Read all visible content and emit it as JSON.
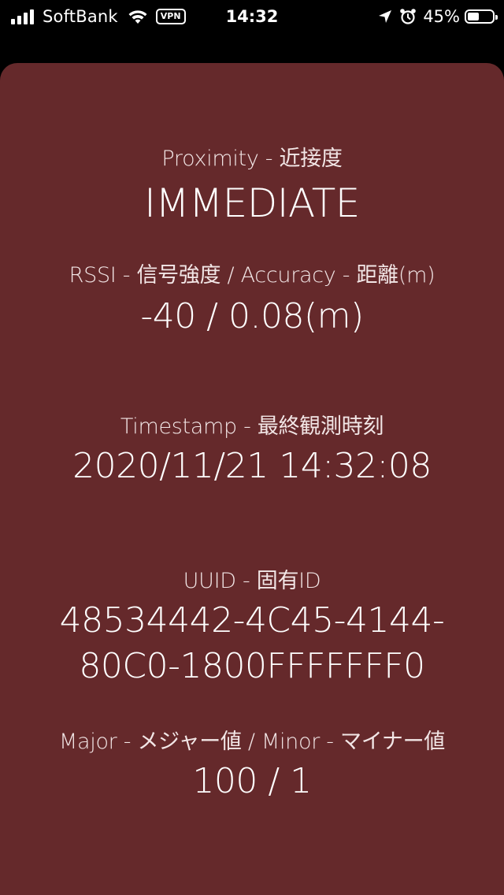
{
  "status_bar": {
    "carrier": "SoftBank",
    "vpn_label": "VPN",
    "time": "14:32",
    "battery_percent": "45%",
    "battery_level": 0.45,
    "icons": [
      "signal-icon",
      "wifi-icon",
      "location-arrow-icon",
      "alarm-clock-icon",
      "battery-icon"
    ]
  },
  "beacon": {
    "proximity_label": "Proximity - 近接度",
    "proximity_value": "IMMEDIATE",
    "rssi_label": "RSSI - 信号強度 / Accuracy - 距離(m)",
    "rssi_value": "-40 / 0.08(m)",
    "timestamp_label": "Timestamp - 最終観測時刻",
    "timestamp_value": "2020/11/21 14:32:08",
    "uuid_label": "UUID - 固有ID",
    "uuid_value_line1": "48534442-4C45-4144-",
    "uuid_value_line2": "80C0-1800FFFFFFF0",
    "major_minor_label": "Major - メジャー値 / Minor - マイナー値",
    "major_minor_value": "100 / 1"
  },
  "colors": {
    "card_background": "#65292b",
    "screen_background": "#000000",
    "text": "#ffffff"
  }
}
